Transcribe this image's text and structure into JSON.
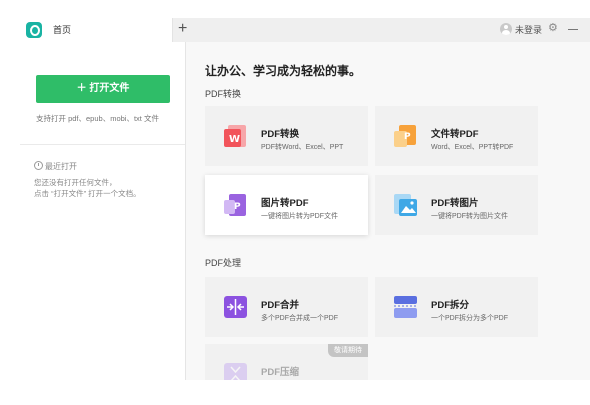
{
  "tab": {
    "label": "首页"
  },
  "titlebar": {
    "new_tab": "+",
    "login": "未登录",
    "settings_glyph": "⚙"
  },
  "sidebar": {
    "open_button": "＋ 打开文件",
    "formats": "支持打开 pdf、epub、mobi、txt 文件",
    "recent_title": "最近打开",
    "empty_line1": "您还没有打开任何文件，",
    "empty_line2": "点击 “打开文件” 打开一个文档。"
  },
  "main": {
    "headline": "让办公、学习成为轻松的事。",
    "sections": [
      {
        "title": "PDF转换",
        "cards": [
          {
            "title": "PDF转换",
            "desc": "PDF转Word、Excel、PPT",
            "icon": "pdf-to-word-icon",
            "color": "#f2545b"
          },
          {
            "title": "文件转PDF",
            "desc": "Word、Excel、PPT转PDF",
            "icon": "file-to-pdf-icon",
            "color": "#f7a23b"
          },
          {
            "title": "图片转PDF",
            "desc": "一键将图片转为PDF文件",
            "icon": "image-to-pdf-icon",
            "color": "#9a63e0"
          },
          {
            "title": "PDF转图片",
            "desc": "一键将PDF转为图片文件",
            "icon": "pdf-to-image-icon",
            "color": "#3fa8e6"
          }
        ]
      },
      {
        "title": "PDF处理",
        "cards": [
          {
            "title": "PDF合并",
            "desc": "多个PDF合并成一个PDF",
            "icon": "pdf-merge-icon",
            "color": "#8c52e0"
          },
          {
            "title": "PDF拆分",
            "desc": "一个PDF拆分为多个PDF",
            "icon": "pdf-split-icon",
            "color": "#5a6fe0"
          },
          {
            "title": "PDF压缩",
            "desc": "",
            "icon": "pdf-compress-icon",
            "color": "#b48ef0",
            "badge": "敬请期待"
          }
        ]
      }
    ]
  }
}
